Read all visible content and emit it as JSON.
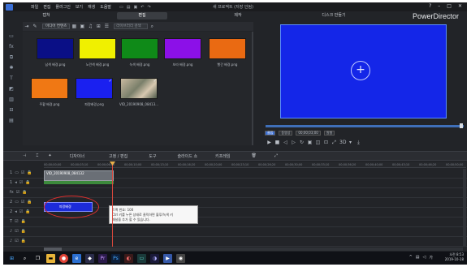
{
  "titlebar": {
    "menu": [
      "파일",
      "편집",
      "플러그인",
      "보기",
      "재생",
      "도움말"
    ],
    "project_title": "새 프로젝트 (저장 안됨)",
    "win_help": "?",
    "win_min": "–",
    "win_max": "□",
    "win_close": "✕"
  },
  "brand": "PowerDirector",
  "mode_tabs": [
    "캡쳐",
    "편집",
    "제작",
    "디스크 만들기"
  ],
  "library": {
    "dropdown": "미디어 컨텐츠",
    "search_placeholder": "라이브러리 검색",
    "tiles": [
      {
        "label": "남색 배경.png",
        "color": "#0a0f86",
        "checked": false
      },
      {
        "label": "노란색 배경.png",
        "color": "#f0f000",
        "checked": false
      },
      {
        "label": "녹색 배경.png",
        "color": "#0f8a18",
        "checked": false
      },
      {
        "label": "보라 배경.png",
        "color": "#8c10e8",
        "checked": false
      },
      {
        "label": "빨간 배경.png",
        "color": "#ea6a12",
        "checked": false
      },
      {
        "label": "주황 배경.png",
        "color": "#f07814",
        "checked": false
      },
      {
        "label": "파랑배경.png",
        "color": "#1a20f0",
        "checked": true
      },
      {
        "label": "VID_20190908_08413...",
        "color": "#8a8f78",
        "checked": true
      }
    ]
  },
  "transport": {
    "mode_label": "클립",
    "mode2_label": "동영상",
    "timecode": "00;00;03;00",
    "quality": "원형",
    "icons": [
      "▶",
      "■",
      "◁",
      "▷",
      "↻",
      "▣",
      "◫",
      "⊡",
      "⤢",
      "3D",
      "▾",
      "⤓"
    ]
  },
  "timeline_tools": [
    "디자이너",
    "고정 / 편집",
    "도구",
    "슬라이드 쇼",
    "키프레임"
  ],
  "ruler_ticks": [
    "00;00;00;00",
    "00;00;03;10",
    "00;00;06;20",
    "00;00;10;00",
    "00;00;13;10",
    "00;00;16;20",
    "00;00;20;00",
    "00;00;23;10",
    "00;00;26;20",
    "00;00;30;00",
    "00;00;33;10",
    "00;00;36;20",
    "00;00;40;00",
    "00;00;43;10",
    "00;00;46;20",
    "00;00;50;00"
  ],
  "tracks": [
    {
      "num": "1"
    },
    {
      "num": "1"
    },
    {
      "num": "fx"
    },
    {
      "num": "2"
    },
    {
      "num": "2"
    },
    {
      "num": "T"
    },
    {
      "num": "♪"
    },
    {
      "num": "♪"
    }
  ],
  "clips": {
    "video": "VID_20190908_084132",
    "color": "파랑배경"
  },
  "tooltip": {
    "line1": "트랙 번호: 100",
    "line2": "Ctrl 키를 누른 상태로 클릭하면 블루/녹색 키",
    "line3": "패널을 추가 할 수 있습니다."
  },
  "taskbar": {
    "time": "오전 8:53",
    "date": "2019-10-18"
  }
}
